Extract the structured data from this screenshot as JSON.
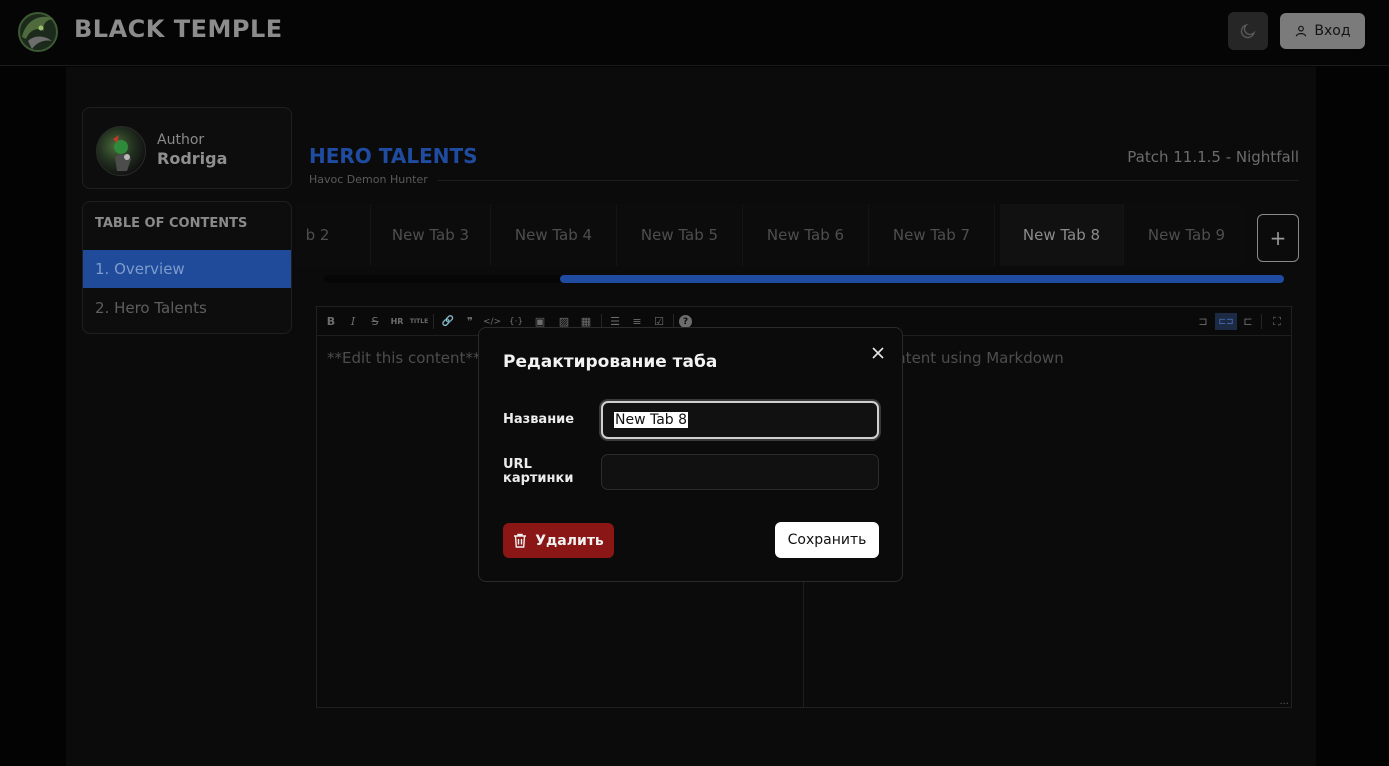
{
  "header": {
    "logo_text": "BLACK TEMPLE",
    "login_label": "Вход",
    "icons": {
      "logo": "dragon-logo-icon",
      "theme": "moon-icon",
      "login": "user-icon"
    }
  },
  "author": {
    "label": "Author",
    "name": "Rodriga"
  },
  "toc": {
    "title": "TABLE OF CONTENTS",
    "items": [
      {
        "label": "1. Overview",
        "active": true
      },
      {
        "label": "2. Hero Talents",
        "active": false
      }
    ]
  },
  "page": {
    "title": "HERO TALENTS",
    "subtitle": "Havoc Demon Hunter",
    "patch": "Patch 11.1.5 - Nightfall"
  },
  "tabs": {
    "items": [
      {
        "label": "b 2"
      },
      {
        "label": "New Tab 3"
      },
      {
        "label": "New Tab 4"
      },
      {
        "label": "New Tab 5"
      },
      {
        "label": "New Tab 6"
      },
      {
        "label": "New Tab 7"
      },
      {
        "label": "New Tab 8",
        "active": true
      },
      {
        "label": "New Tab 9"
      }
    ],
    "add_label": "+"
  },
  "editor": {
    "left_text": "**Edit this content**",
    "right_text": "ontent using Markdown",
    "resize_dots": "...",
    "toolbar": [
      {
        "label": "B",
        "icon": "bold-icon"
      },
      {
        "label": "I",
        "icon": "italic-icon"
      },
      {
        "label": "S",
        "icon": "strikethrough-icon"
      },
      {
        "label": "HR",
        "icon": "horizontal-rule-icon"
      },
      {
        "label": "TITLE",
        "icon": "title-icon"
      },
      {
        "label": "🔗",
        "icon": "link-icon"
      },
      {
        "label": "❞",
        "icon": "quote-icon"
      },
      {
        "label": "</>",
        "icon": "code-icon"
      },
      {
        "label": "{·}",
        "icon": "code-block-icon"
      },
      {
        "label": "▣",
        "icon": "comment-icon"
      },
      {
        "label": "▨",
        "icon": "image-icon"
      },
      {
        "label": "▦",
        "icon": "table-icon"
      },
      {
        "label": "☰",
        "icon": "unordered-list-icon"
      },
      {
        "label": "≡",
        "icon": "ordered-list-icon"
      },
      {
        "label": "☑",
        "icon": "checklist-icon"
      },
      {
        "label": "?",
        "icon": "help-icon"
      }
    ],
    "view_toolbar": [
      {
        "label": "⊐",
        "icon": "edit-only-icon"
      },
      {
        "label": "⊏⊐",
        "icon": "live-preview-icon",
        "active": true
      },
      {
        "label": "⊏",
        "icon": "preview-only-icon"
      },
      {
        "label": "⛶",
        "icon": "fullscreen-icon"
      }
    ]
  },
  "modal": {
    "title": "Редактирование таба",
    "name_label": "Название",
    "name_value": "New Tab 8",
    "url_label_line1": "URL",
    "url_label_line2": "картинки",
    "url_value": "",
    "delete_label": "Удалить",
    "save_label": "Сохранить",
    "icons": {
      "close": "close-icon",
      "delete": "trash-icon"
    }
  },
  "colors": {
    "accent": "#1f4ca0",
    "danger": "#8a1616",
    "background": "#030303"
  }
}
